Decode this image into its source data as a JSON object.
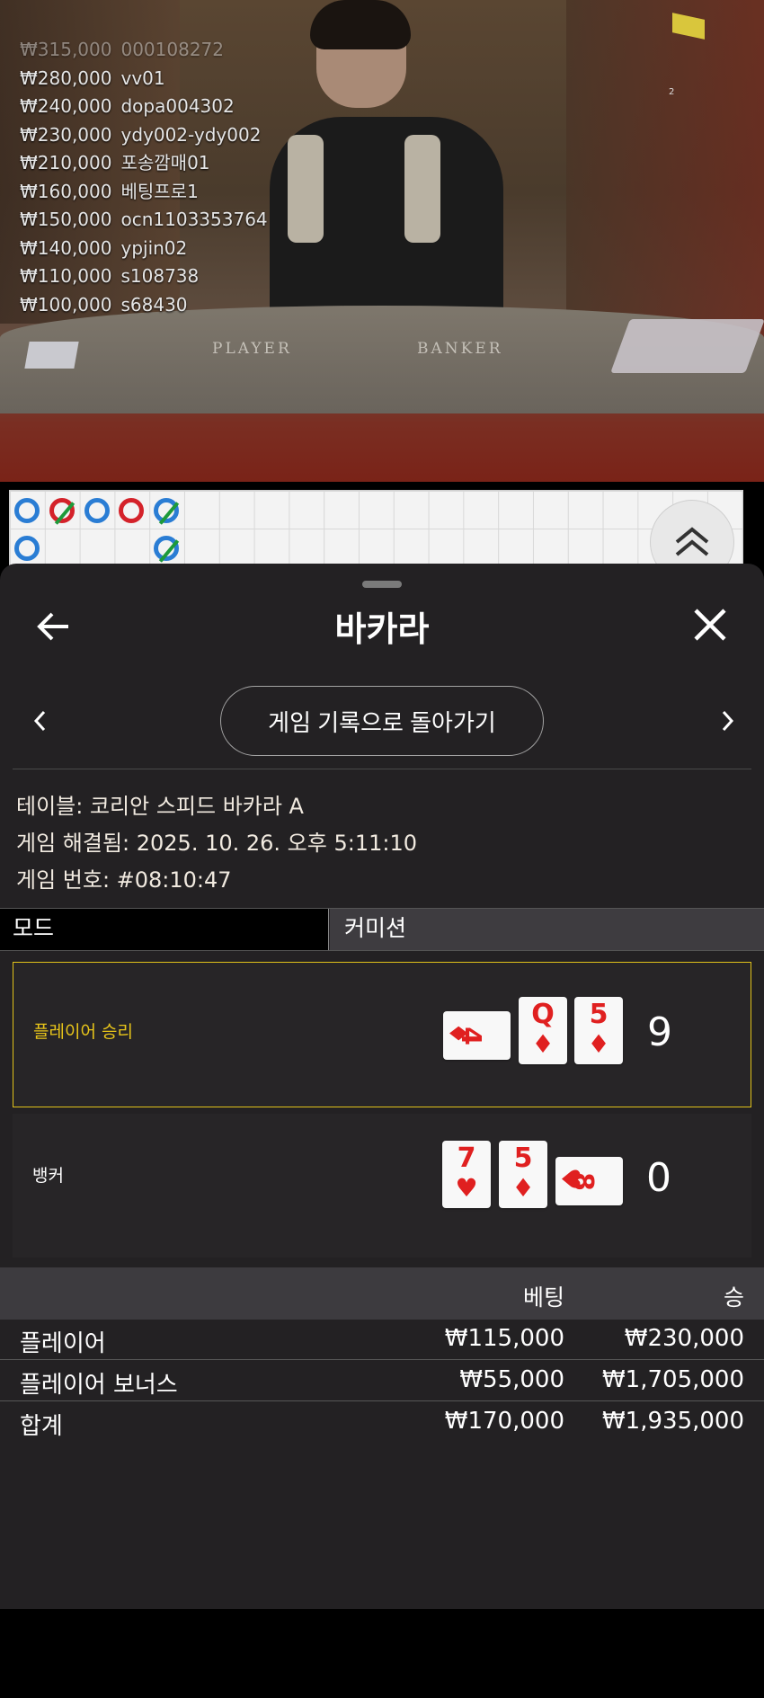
{
  "video": {
    "leaderboard": [
      {
        "amount": "₩315,000",
        "user": "000108272",
        "faded": true
      },
      {
        "amount": "₩280,000",
        "user": "vv01"
      },
      {
        "amount": "₩240,000",
        "user": "dopa004302"
      },
      {
        "amount": "₩230,000",
        "user": "ydy002-ydy002"
      },
      {
        "amount": "₩210,000",
        "user": "포송깜매01"
      },
      {
        "amount": "₩160,000",
        "user": "베팅프로1"
      },
      {
        "amount": "₩150,000",
        "user": "ocn1103353764"
      },
      {
        "amount": "₩140,000",
        "user": "ypjin02"
      },
      {
        "amount": "₩110,000",
        "user": "s108738"
      },
      {
        "amount": "₩100,000",
        "user": "s68430"
      }
    ],
    "mini_number": "2",
    "table_player": "PLAYER",
    "table_banker": "BANKER"
  },
  "roadmap": {
    "colors": {
      "player": "#2a7dd4",
      "banker": "#d4222a",
      "tie_slash": "#1e9a3a"
    },
    "beads": [
      {
        "col": 0,
        "row": 0,
        "side": "player",
        "tie": false
      },
      {
        "col": 1,
        "row": 0,
        "side": "banker",
        "tie": true
      },
      {
        "col": 2,
        "row": 0,
        "side": "player",
        "tie": false
      },
      {
        "col": 3,
        "row": 0,
        "side": "banker",
        "tie": false
      },
      {
        "col": 4,
        "row": 0,
        "side": "player",
        "tie": true
      },
      {
        "col": 0,
        "row": 1,
        "side": "player",
        "tie": false
      },
      {
        "col": 4,
        "row": 1,
        "side": "player",
        "tie": true
      }
    ],
    "scroll_icon": "double-chevron-up-icon"
  },
  "sheet": {
    "title": "바카라",
    "back_icon": "arrow-left-icon",
    "close_icon": "close-icon",
    "history_button": "게임 기록으로 돌아가기",
    "table_info": "테이블: 코리안 스피드 바카라 A",
    "resolved_info": "게임 해결됨: 2025. 10. 26. 오후 5:11:10",
    "game_number_info": "게임 번호: #08:10:47",
    "mode_label": "모드",
    "mode_value": "커미션",
    "accent_color": "#e1c21a"
  },
  "results": {
    "player": {
      "label": "플레이어 승리",
      "score": "9",
      "cards": [
        {
          "rank": "4",
          "suit": "♦",
          "orientation": "horizontal"
        },
        {
          "rank": "Q",
          "suit": "♦",
          "orientation": "vertical"
        },
        {
          "rank": "5",
          "suit": "♦",
          "orientation": "vertical"
        }
      ]
    },
    "banker": {
      "label": "뱅커",
      "score": "0",
      "cards": [
        {
          "rank": "7",
          "suit": "♥",
          "orientation": "vertical"
        },
        {
          "rank": "5",
          "suit": "♦",
          "orientation": "vertical"
        },
        {
          "rank": "8",
          "suit": "♥",
          "orientation": "horizontal"
        }
      ]
    }
  },
  "bets": {
    "col_bet": "베팅",
    "col_win": "승",
    "rows": [
      {
        "name": "플레이어",
        "bet": "₩115,000",
        "win": "₩230,000"
      },
      {
        "name": "플레이어 보너스",
        "bet": "₩55,000",
        "win": "₩1,705,000"
      },
      {
        "name": "합계",
        "bet": "₩170,000",
        "win": "₩1,935,000"
      }
    ]
  }
}
